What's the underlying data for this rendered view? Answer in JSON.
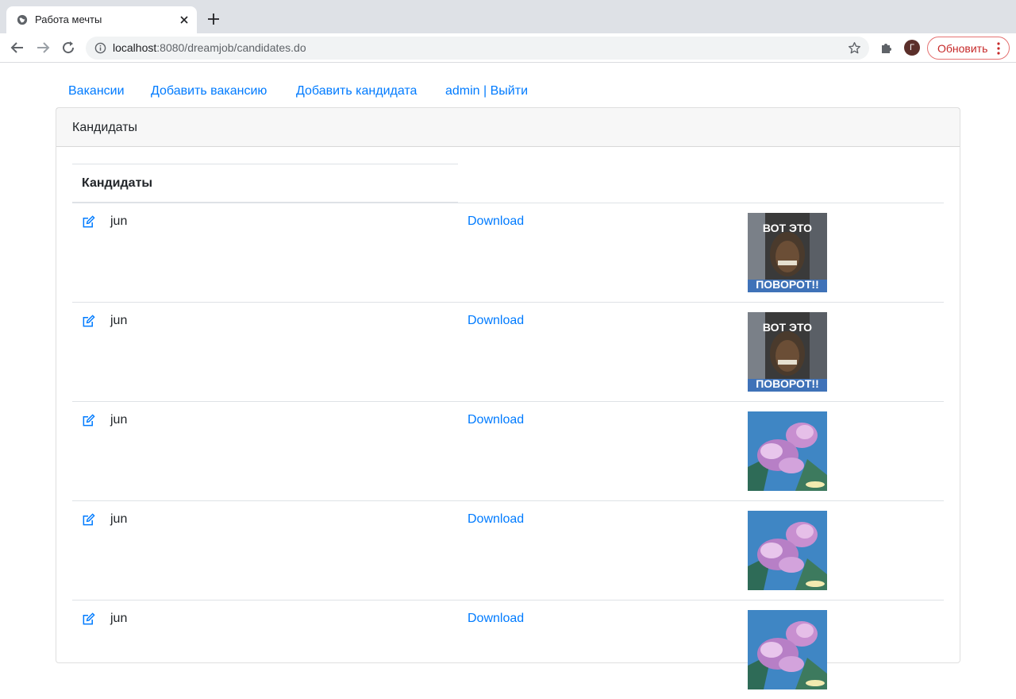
{
  "browser": {
    "tab_title": "Работа мечты",
    "url_host": "localhost",
    "url_path": ":8080/dreamjob/candidates.do",
    "avatar_letter": "Г",
    "update_label": "Обновить"
  },
  "nav": {
    "items": [
      "Вакансии",
      "Добавить вакансию",
      "Добавить кандидата",
      "admin | Выйти"
    ]
  },
  "card": {
    "header": "Кандидаты",
    "table_header": "Кандидаты"
  },
  "candidates": [
    {
      "name": "jun",
      "download": "Download",
      "photo": "meme",
      "photo_caption_top": "ВОТ  ЭТО",
      "photo_caption_bottom": "ПОВОРОТ!!"
    },
    {
      "name": "jun",
      "download": "Download",
      "photo": "meme",
      "photo_caption_top": "ВОТ  ЭТО",
      "photo_caption_bottom": "ПОВОРОТ!!"
    },
    {
      "name": "jun",
      "download": "Download",
      "photo": "flowers"
    },
    {
      "name": "jun",
      "download": "Download",
      "photo": "flowers"
    },
    {
      "name": "jun",
      "download": "Download",
      "photo": "flowers"
    }
  ],
  "colors": {
    "link": "#007bff",
    "accent_update": "#c62828"
  }
}
